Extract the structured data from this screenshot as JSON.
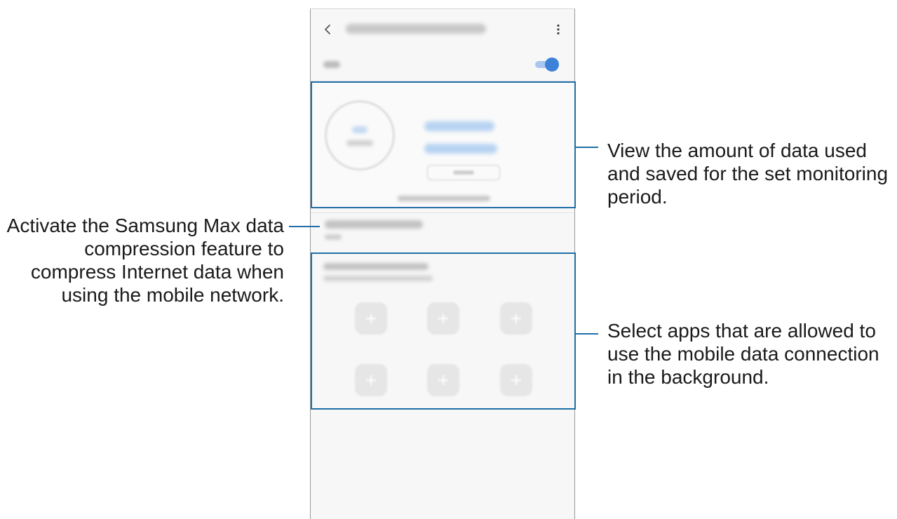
{
  "phone": {
    "app_bar": {
      "back_icon": "chevron-left-icon",
      "more_icon": "more-vertical-icon"
    },
    "toggle": {
      "state": "on",
      "track_color": "#a8c7ee",
      "knob_color": "#3d82d8"
    },
    "app_slots": 6
  },
  "callouts": {
    "usage": "View the amount of data used and saved for the set monitoring period.",
    "compression": "Activate the Samsung Max data compression feature to compress Internet data when using the mobile network.",
    "background_apps": "Select apps that are allowed to use the mobile data connection in the background."
  },
  "colors": {
    "callout_border": "#1f6fa8",
    "accent": "#3d82d8",
    "text": "#1a1a1a"
  }
}
